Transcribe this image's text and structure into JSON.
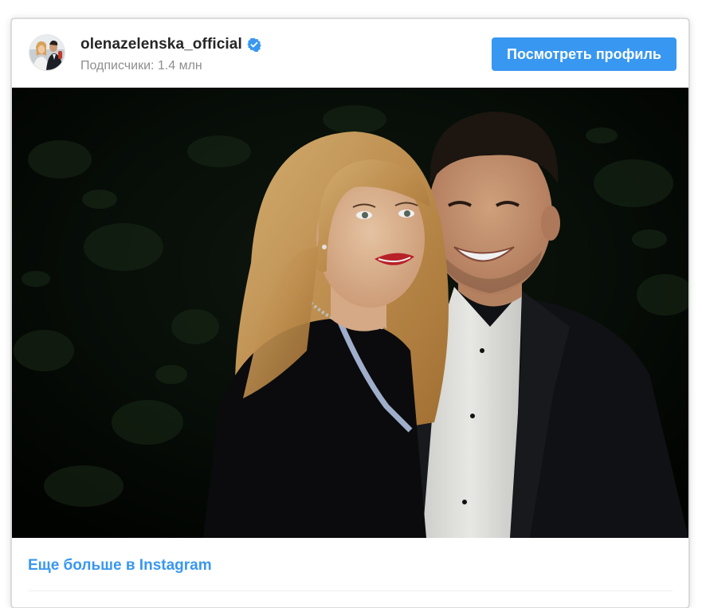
{
  "profile": {
    "username": "olenazelenska_official",
    "verified": true,
    "followers": "Подписчики: 1.4 млн",
    "view_profile_label": "Посмотреть профиль"
  },
  "post": {
    "image_alt": "Фото olenazelenska_official"
  },
  "footer": {
    "more_link": "Еще больше в Instagram"
  },
  "colors": {
    "accent": "#3897f0",
    "username": "#262626",
    "secondary_text": "#8e8e8e",
    "border": "#dbdbdb"
  },
  "icons": {
    "verified": "verified-badge-icon"
  }
}
